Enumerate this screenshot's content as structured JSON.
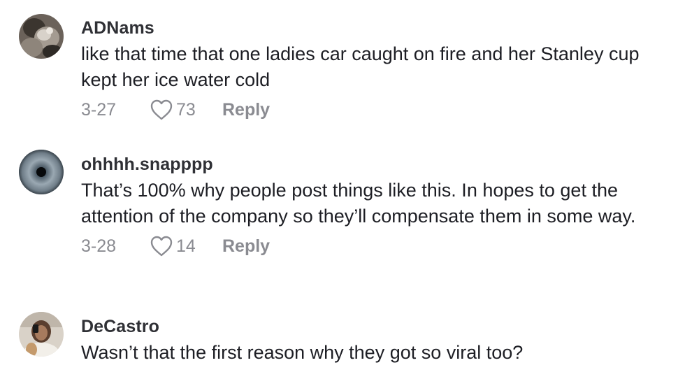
{
  "comments": [
    {
      "username": "ADNams",
      "text": "like that time that one ladies car caught on fire and her Stanley cup kept her ice water cold",
      "date": "3-27",
      "likes": "73",
      "reply_label": "Reply",
      "avatar_icon": "user-avatar-photo"
    },
    {
      "username": "ohhhh.snapppp",
      "text": "That’s 100% why people post things like this. In hopes to get the attention of the company so they’ll compensate them in some way.",
      "date": "3-28",
      "likes": "14",
      "reply_label": "Reply",
      "avatar_icon": "eye-avatar"
    },
    {
      "username": "DeCastro",
      "text": "Wasn’t that the first reason why they got so viral too?",
      "avatar_icon": "user-avatar-photo"
    }
  ],
  "icons": {
    "like": "heart-outline-icon"
  },
  "colors": {
    "username": "#2f3035",
    "text": "#1d1e24",
    "meta": "#8a8b91",
    "background": "#ffffff"
  }
}
